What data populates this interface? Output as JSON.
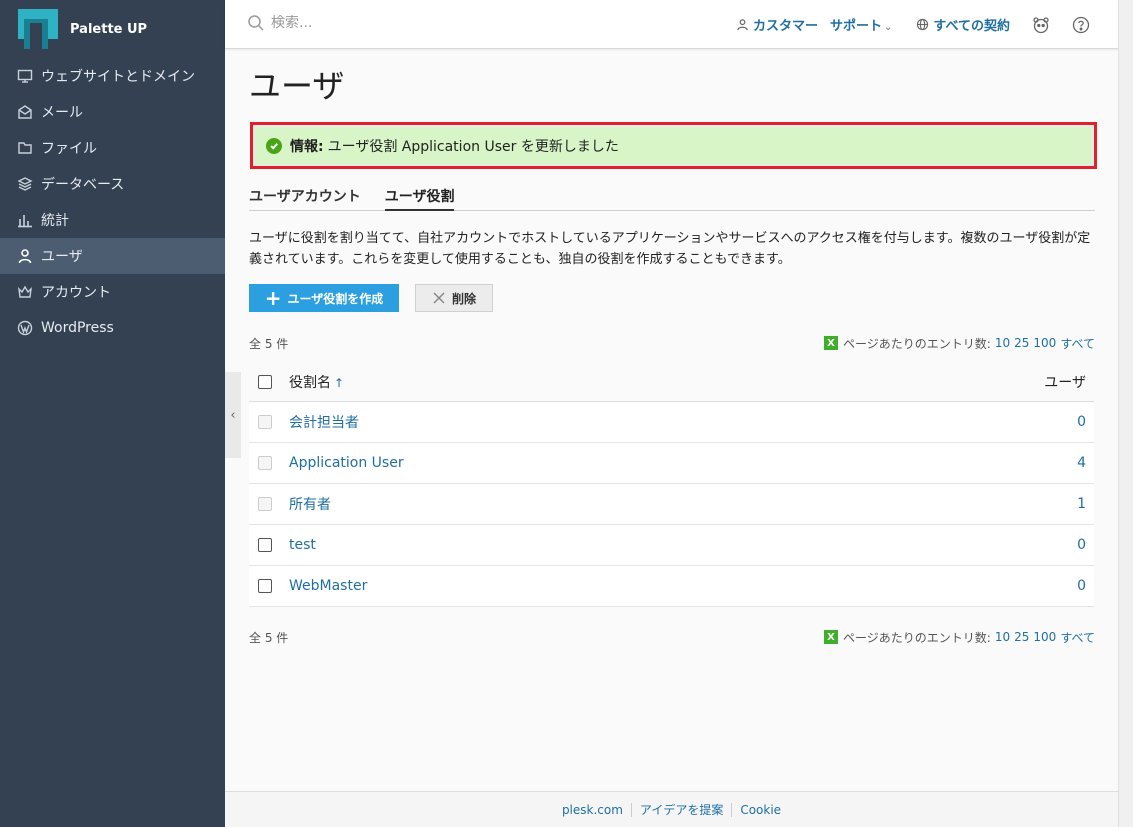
{
  "sidebar": {
    "brand": "Palette UP",
    "items": [
      {
        "label": "ウェブサイトとドメイン",
        "icon": "monitor-icon"
      },
      {
        "label": "メール",
        "icon": "mail-icon"
      },
      {
        "label": "ファイル",
        "icon": "folder-icon"
      },
      {
        "label": "データベース",
        "icon": "database-icon"
      },
      {
        "label": "統計",
        "icon": "chart-icon"
      },
      {
        "label": "ユーザ",
        "icon": "user-icon",
        "active": true
      },
      {
        "label": "アカウント",
        "icon": "crown-icon"
      },
      {
        "label": "WordPress",
        "icon": "wordpress-icon"
      }
    ]
  },
  "topbar": {
    "search_placeholder": "検索...",
    "customer": "カスタマー",
    "support": "サポート",
    "subscriptions": "すべての契約"
  },
  "page": {
    "title": "ユーザ",
    "message_label": "情報:",
    "message_text": "ユーザ役割 Application User を更新しました",
    "tabs": [
      {
        "label": "ユーザアカウント",
        "active": false
      },
      {
        "label": "ユーザ役割",
        "active": true
      }
    ],
    "description": "ユーザに役割を割り当てて、自社アカウントでホストしているアプリケーションやサービスへのアクセス権を付与します。複数のユーザ役割が定義されています。これらを変更して使用することも、独自の役割を作成することもできます。",
    "create_button": "ユーザ役割を作成",
    "delete_button": "削除",
    "total": "全 5 件",
    "per_page_label": "ページあたりのエントリ数:",
    "per_page_options": [
      "10",
      "25",
      "100",
      "すべて"
    ],
    "columns": {
      "name": "役割名",
      "users": "ユーザ"
    },
    "rows": [
      {
        "name": "会計担当者",
        "users": "0",
        "selectable": false
      },
      {
        "name": "Application User",
        "users": "4",
        "selectable": false
      },
      {
        "name": "所有者",
        "users": "1",
        "selectable": false
      },
      {
        "name": "test",
        "users": "0",
        "selectable": true
      },
      {
        "name": "WebMaster",
        "users": "0",
        "selectable": true
      }
    ]
  },
  "footer": {
    "links": [
      "plesk.com",
      "アイデアを提案",
      "Cookie"
    ]
  },
  "colors": {
    "sidebar_bg": "#344152",
    "accent": "#2b9fe0",
    "link": "#1f6fa3",
    "success_bg": "#d8f5c7",
    "highlight_border": "#e0202a"
  }
}
